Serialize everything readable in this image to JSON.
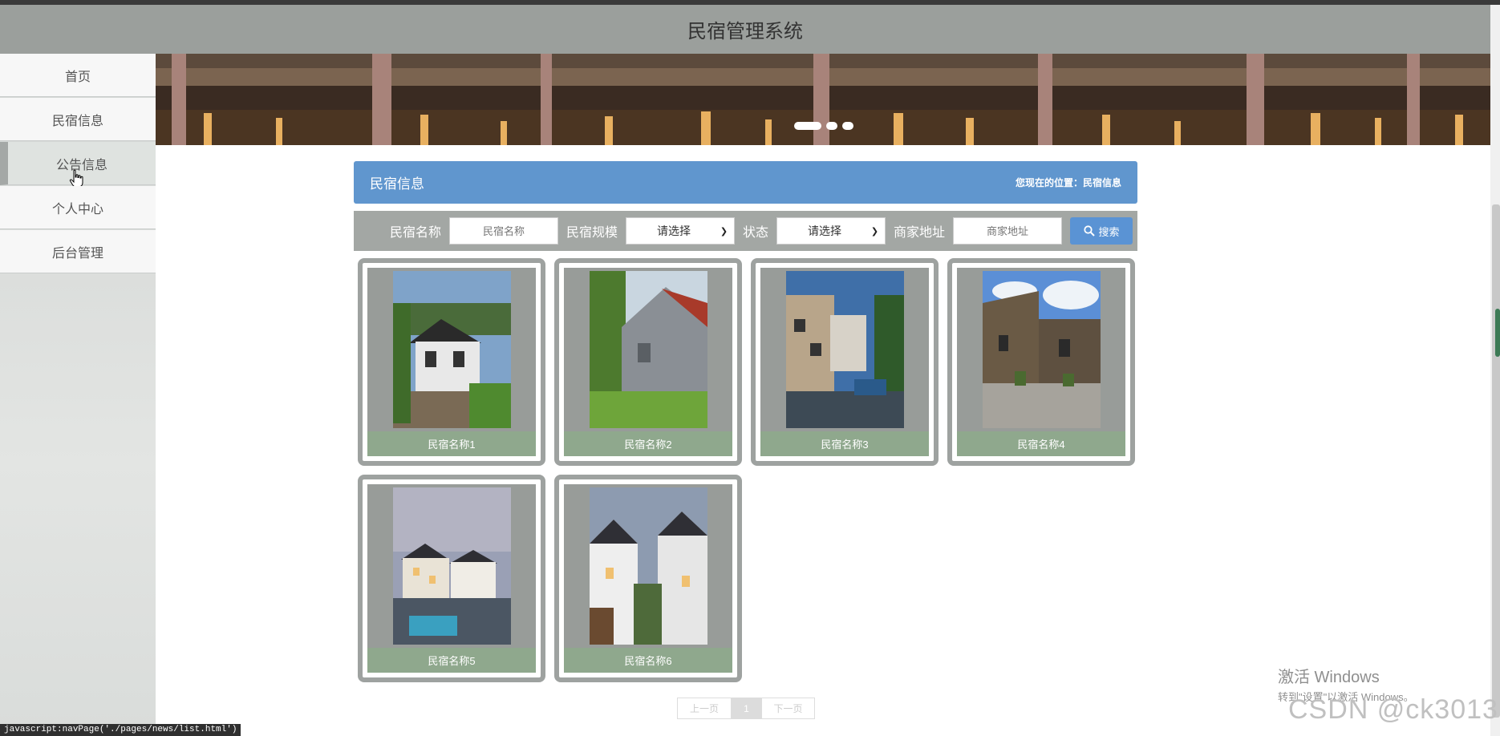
{
  "header": {
    "title": "民宿管理系统"
  },
  "sidebar": {
    "items": [
      {
        "label": "首页"
      },
      {
        "label": "民宿信息"
      },
      {
        "label": "公告信息"
      },
      {
        "label": "个人中心"
      },
      {
        "label": "后台管理"
      }
    ]
  },
  "panel": {
    "title": "民宿信息",
    "breadcrumb": "您现在的位置：民宿信息"
  },
  "search": {
    "name_label": "民宿名称",
    "name_placeholder": "民宿名称",
    "scale_label": "民宿规模",
    "scale_value": "请选择",
    "status_label": "状态",
    "status_value": "请选择",
    "address_label": "商家地址",
    "address_placeholder": "商家地址",
    "button_label": "搜索"
  },
  "cards": [
    {
      "name": "民宿名称1"
    },
    {
      "name": "民宿名称2"
    },
    {
      "name": "民宿名称3"
    },
    {
      "name": "民宿名称4"
    },
    {
      "name": "民宿名称5"
    },
    {
      "name": "民宿名称6"
    }
  ],
  "pagination": {
    "prev": "上一页",
    "current": "1",
    "next": "下一页"
  },
  "os_overlay": {
    "activate_title": "激活 Windows",
    "activate_sub": "转到\"设置\"以激活 Windows。"
  },
  "watermark": "CSDN @ck3013",
  "statusbar": "javascript:navPage('./pages/news/list.html')",
  "colors": {
    "header": "#9b9f9c",
    "accent": "#6096ce",
    "card_label": "#8fa88d",
    "button": "#5a93d4"
  }
}
